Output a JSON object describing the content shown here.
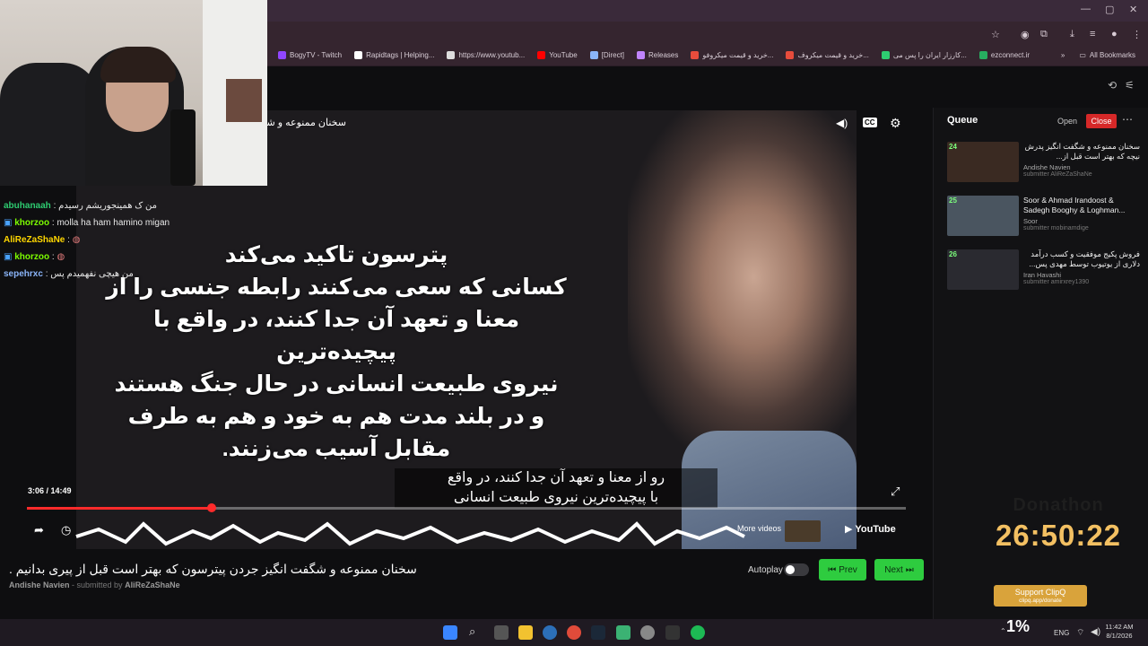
{
  "browser": {
    "bookmarks": [
      {
        "label": "BogyTV - Twitch",
        "color": "#9146ff"
      },
      {
        "label": "Rapidtags | Helping...",
        "color": "#ffffff"
      },
      {
        "label": "https://www.youtub...",
        "color": "#dddddd"
      },
      {
        "label": "YouTube",
        "color": "#ff0000"
      },
      {
        "label": "[Direct]",
        "color": "#8ab4f8"
      },
      {
        "label": "Releases",
        "color": "#c084fc"
      },
      {
        "label": "خرید و قیمت میکروفو...",
        "color": "#e74c3c"
      },
      {
        "label": "خرید و قیمت میکروف...",
        "color": "#e74c3c"
      },
      {
        "label": "کارزار ایران را پس می...",
        "color": "#2ecc71"
      },
      {
        "label": "ezconnect.ir",
        "color": "#27ae60"
      }
    ],
    "all_bookmarks_label": "All Bookmarks"
  },
  "video": {
    "overlay_title": "سخنان ممنوعه و شگفت انگیز جردن پیترسون که بهتر است قبل از پیری بدانیم .",
    "quote_lines": [
      "پترسون تاکید می‌کند",
      "کسانی که سعی می‌کنند رابطه جنسی را از",
      "معنا و تعهد آن جدا کنند، در واقع با پیچیده‌ترین",
      "نیروی طبیعت انسانی در حال جنگ هستند",
      "و در بلند مدت هم به خود و هم به طرف",
      "مقابل آسیب می‌زنند."
    ],
    "subtitle_lines": [
      "رو از معنا و تعهد آن جدا کنند، در واقع",
      "با پیچیده‌ترین نیروی طبیعت انسانی"
    ],
    "time": "3:06 / 14:49",
    "progress": 0.21,
    "cc_label": "CC",
    "more_videos": "More videos",
    "youtube_label": "YouTube"
  },
  "chat": [
    {
      "user": "abuhanaah",
      "text": "من ک همینجوریشم رسیدم",
      "color": "#2ecc71"
    },
    {
      "user": "khorzoo",
      "text": "molla ha ham hamino migan",
      "color": "#7cfc00",
      "badge": true
    },
    {
      "user": "AliReZaShaNe",
      "text": "",
      "color": "#ffd700"
    },
    {
      "user": "khorzoo",
      "text": "",
      "color": "#7cfc00",
      "badge": true
    },
    {
      "user": "sepehrxc",
      "text": "من هیچی نفهمیدم پس",
      "color": "#8ab4f8"
    }
  ],
  "queue": {
    "title": "Queue",
    "open_label": "Open",
    "close_label": "Close",
    "items": [
      {
        "num": "24",
        "title": "سخنان ممنوعه و شگفت انگیز پدرش نیچه که بهتر است قبل از...",
        "author": "Andishe Navien",
        "submitter": "submitter AliReZaShaNe",
        "thumb": "#3a2a22"
      },
      {
        "num": "25",
        "title": "Soor & Ahmad Irandoost & Sadegh Booghy & Loghman...",
        "author": "Soor",
        "submitter": "submitter mobinamdige",
        "thumb": "#4a5560"
      },
      {
        "num": "26",
        "title": "فروش پکیج موفقیت و کسب درآمد دلاری از یوتیوب توسط مهدی پس...",
        "author": "Iran Havashi",
        "submitter": "submitter amirxrey1390",
        "thumb": "#2a2a30"
      }
    ]
  },
  "donathon": {
    "label": "Donathon",
    "timer": "26:50:22"
  },
  "below": {
    "title": "سخنان ممنوعه و شگفت انگیز جردن پیترسون که بهتر است قبل از پیری بدانیم .",
    "channel": "Andishe Navien",
    "submitted_by": "submitted by",
    "submitter": "AliReZaShaNe",
    "autoplay_label": "Autoplay",
    "autoplay_on": false,
    "prev_label": "Prev",
    "next_label": "Next"
  },
  "clipq": {
    "label": "Support ClipQ",
    "sub": "clipq.app/donate"
  },
  "taskbar": {
    "percent": "1%",
    "lang": "ENG",
    "time": "11:42 AM",
    "date": "8/1/2026"
  }
}
